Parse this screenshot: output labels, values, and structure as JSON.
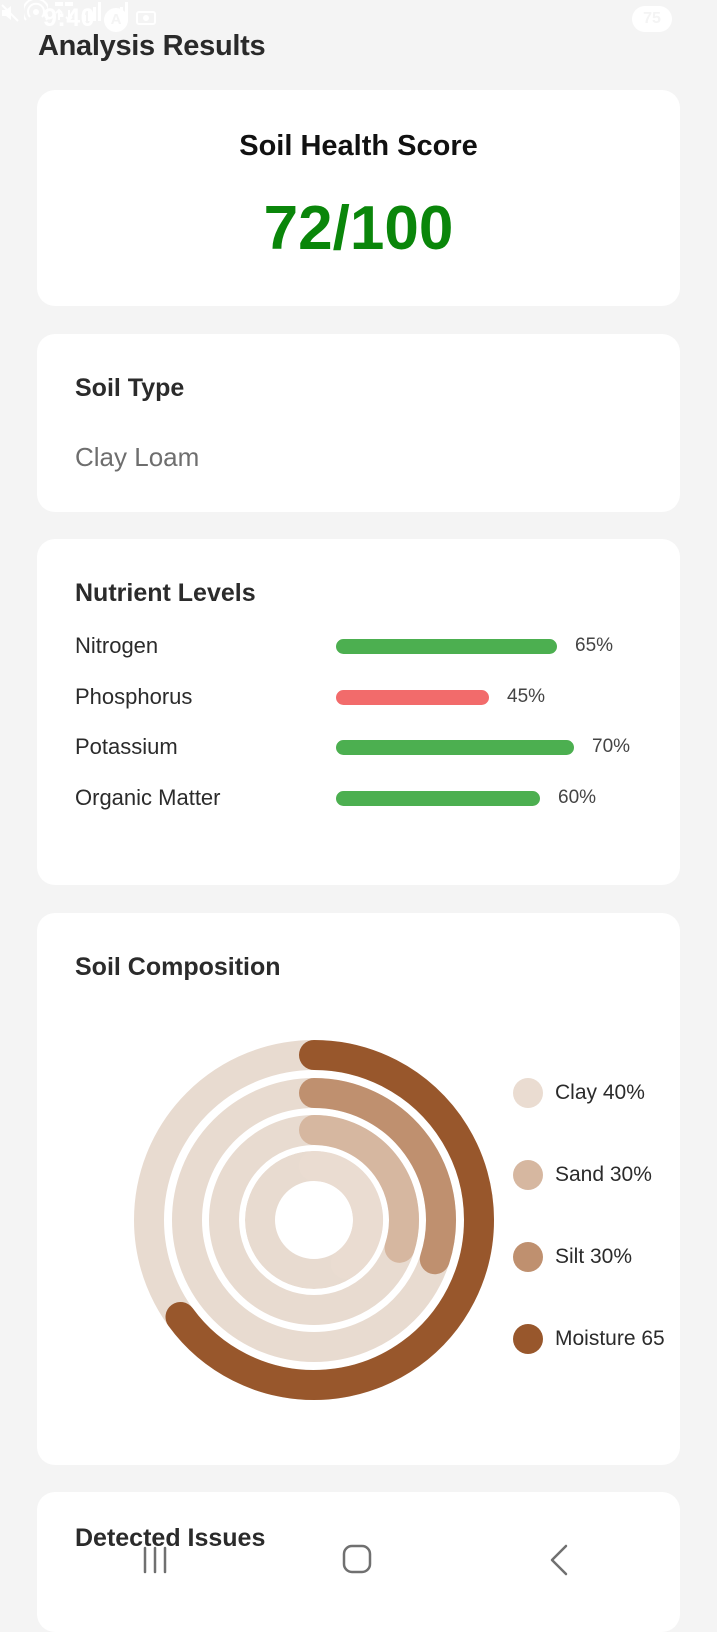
{
  "status_bar": {
    "time": "9:40",
    "badge": "A",
    "battery": "75",
    "icons": [
      "mute-icon",
      "hotspot-icon",
      "data-speed-icon",
      "signal-icon",
      "signal-icon",
      "battery-icon"
    ]
  },
  "page": {
    "title": "Analysis Results"
  },
  "score_card": {
    "label": "Soil Health Score",
    "value": "72/100",
    "score": 72,
    "max": 100,
    "color": "#0a860a"
  },
  "soil_type": {
    "heading": "Soil Type",
    "value": "Clay Loam"
  },
  "nutrients": {
    "heading": "Nutrient Levels",
    "items": [
      {
        "name": "Nitrogen",
        "value": 65,
        "label": "65%",
        "color": "#4caf50"
      },
      {
        "name": "Phosphorus",
        "value": 45,
        "label": "45%",
        "color": "#f26b6b"
      },
      {
        "name": "Potassium",
        "value": 70,
        "label": "70%",
        "color": "#4caf50"
      },
      {
        "name": "Organic Matter",
        "value": 60,
        "label": "60%",
        "color": "#4caf50"
      }
    ]
  },
  "composition": {
    "heading": "Soil Composition",
    "track_color": "#e8dbd0",
    "chart_data": {
      "type": "radial-bar",
      "series": [
        {
          "name": "Clay",
          "value": 40,
          "color": "#eadcd1"
        },
        {
          "name": "Sand",
          "value": 30,
          "color": "#d6b7a0"
        },
        {
          "name": "Silt",
          "value": 30,
          "color": "#bf906f"
        },
        {
          "name": "Moisture",
          "value": 65,
          "color": "#98572c"
        }
      ]
    },
    "legend": [
      {
        "label": "Clay 40%",
        "color": "#eadcd1"
      },
      {
        "label": "Sand 30%",
        "color": "#d6b7a0"
      },
      {
        "label": "Silt 30%",
        "color": "#bf906f"
      },
      {
        "label": "Moisture 65",
        "color": "#98572c"
      }
    ]
  },
  "issues": {
    "heading": "Detected Issues"
  },
  "nav_bar": {
    "icons": [
      "recent-apps-icon",
      "home-icon",
      "back-icon"
    ]
  }
}
